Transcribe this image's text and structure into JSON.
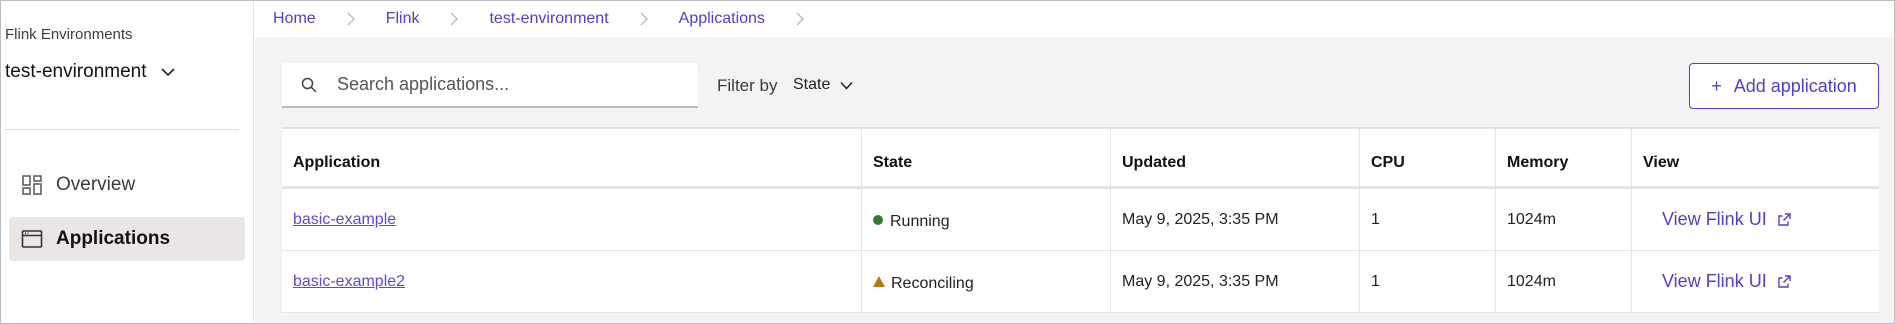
{
  "sidebar": {
    "env_label": "Flink Environments",
    "env_selected": "test-environment",
    "items": [
      {
        "label": "Overview",
        "icon": "dashboard-icon"
      },
      {
        "label": "Applications",
        "icon": "browser-window-icon"
      }
    ]
  },
  "breadcrumb": [
    "Home",
    "Flink",
    "test-environment",
    "Applications"
  ],
  "toolbar": {
    "search_placeholder": "Search applications...",
    "filter_label": "Filter by",
    "filter_value": "State",
    "add_label": "Add application"
  },
  "table": {
    "columns": [
      "Application",
      "State",
      "Updated",
      "CPU",
      "Memory",
      "View"
    ],
    "rows": [
      {
        "application": "basic-example",
        "state": "Running",
        "updated": "May 9, 2025, 3:35 PM",
        "cpu": "1",
        "memory": "1024m",
        "view": "View Flink UI"
      },
      {
        "application": "basic-example2",
        "state": "Reconciling",
        "updated": "May 9, 2025, 3:35 PM",
        "cpu": "1",
        "memory": "1024m",
        "view": "View Flink UI"
      }
    ]
  },
  "colors": {
    "accent": "#4d3fcf",
    "running": "#2e7d32",
    "reconciling": "#b07d0d"
  }
}
